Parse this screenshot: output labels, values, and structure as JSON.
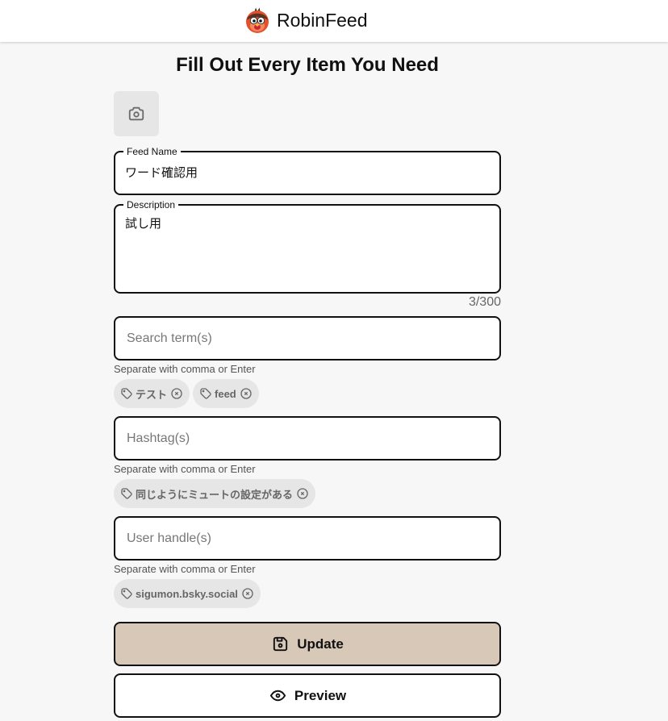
{
  "header": {
    "app_name": "RobinFeed",
    "logo_icon": "robin-logo-icon"
  },
  "form": {
    "title": "Fill Out Every Item You Need",
    "image_upload": {
      "icon": "camera-icon"
    },
    "feed_name": {
      "label": "Feed Name",
      "value": "ワード確認用"
    },
    "description": {
      "label": "Description",
      "value": "試し用",
      "counter": "3/300"
    },
    "search_terms": {
      "placeholder": "Search term(s)",
      "helper": "Separate with comma or Enter",
      "chips": [
        "テスト",
        "feed"
      ]
    },
    "hashtags": {
      "placeholder": "Hashtag(s)",
      "helper": "Separate with comma or Enter",
      "chips": [
        "同じようにミュートの設定がある"
      ]
    },
    "user_handles": {
      "placeholder": "User handle(s)",
      "helper": "Separate with comma or Enter",
      "chips": [
        "sigumon.bsky.social"
      ]
    },
    "update_button": {
      "label": "Update",
      "icon": "save-icon"
    },
    "preview_button": {
      "label": "Preview",
      "icon": "eye-icon"
    }
  },
  "chip_icons": {
    "tag": "tag-icon",
    "remove": "x-circle-icon"
  },
  "colors": {
    "page_bg": "#f7f7f7",
    "header_bg": "#ffffff",
    "field_border": "#111111",
    "update_bg": "#d8c8b8",
    "chip_bg": "#e6e6e6",
    "muted_text": "#6b6b6b"
  }
}
